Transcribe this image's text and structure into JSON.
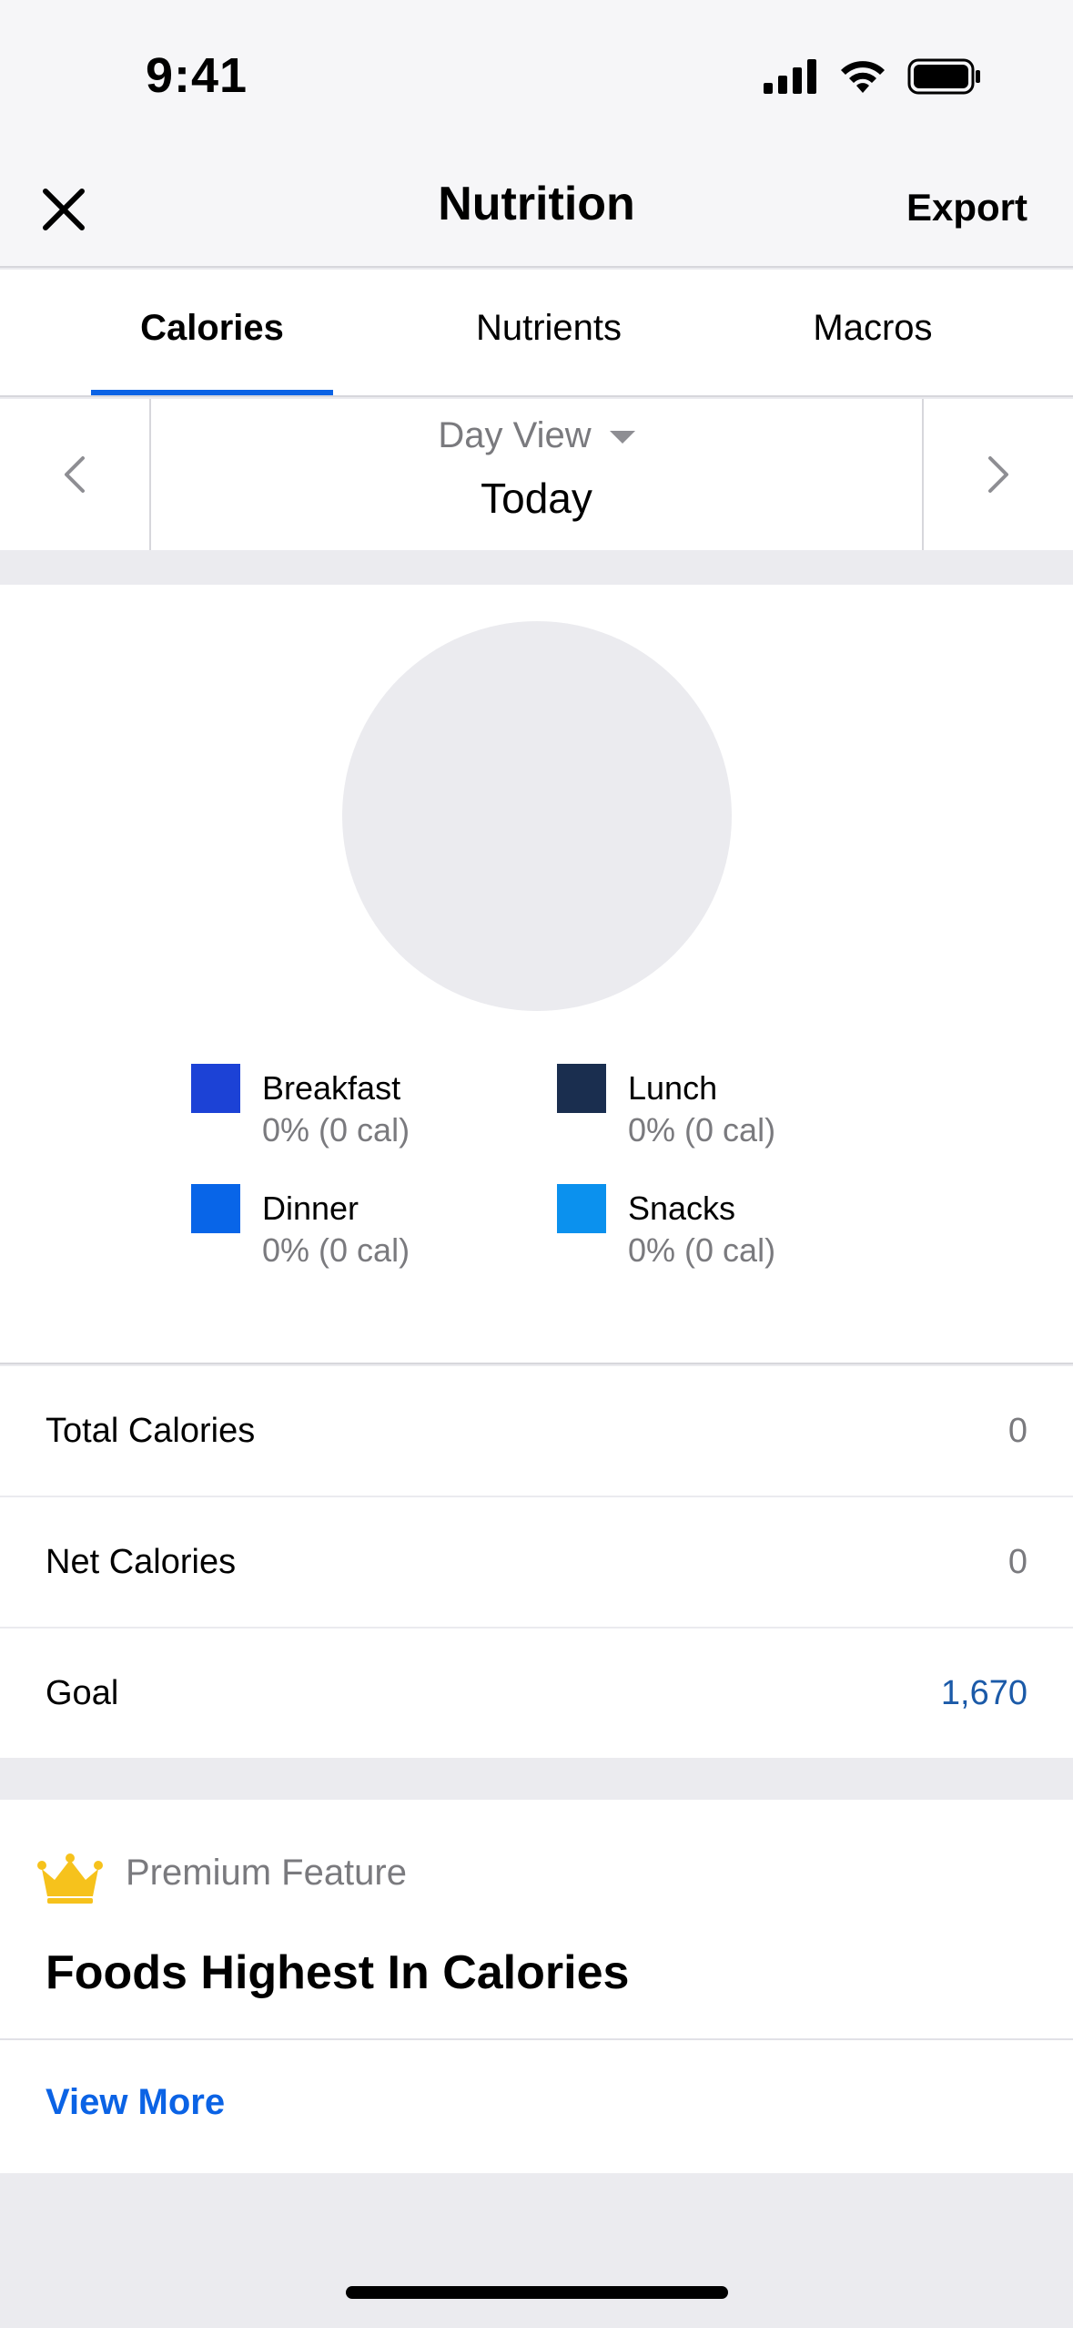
{
  "status_bar": {
    "time": "9:41"
  },
  "header": {
    "title": "Nutrition",
    "export_label": "Export"
  },
  "tabs": [
    {
      "label": "Calories",
      "active": true
    },
    {
      "label": "Nutrients",
      "active": false
    },
    {
      "label": "Macros",
      "active": false
    }
  ],
  "date_nav": {
    "view_label": "Day View",
    "date_label": "Today"
  },
  "legend": [
    {
      "name": "Breakfast",
      "value": "0% (0 cal)",
      "color": "#1c42d6"
    },
    {
      "name": "Lunch",
      "value": "0% (0 cal)",
      "color": "#1a2e4f"
    },
    {
      "name": "Dinner",
      "value": "0% (0 cal)",
      "color": "#0865e8"
    },
    {
      "name": "Snacks",
      "value": "0% (0 cal)",
      "color": "#0b91ee"
    }
  ],
  "summary": {
    "total_label": "Total Calories",
    "total_value": "0",
    "net_label": "Net Calories",
    "net_value": "0",
    "goal_label": "Goal",
    "goal_value": "1,670"
  },
  "premium": {
    "badge_label": "Premium Feature",
    "title": "Foods Highest In Calories",
    "view_more_label": "View More"
  },
  "colors": {
    "accent": "#0b63e5",
    "goal_value": "#1b5aa8",
    "crown": "#f6c21c"
  }
}
